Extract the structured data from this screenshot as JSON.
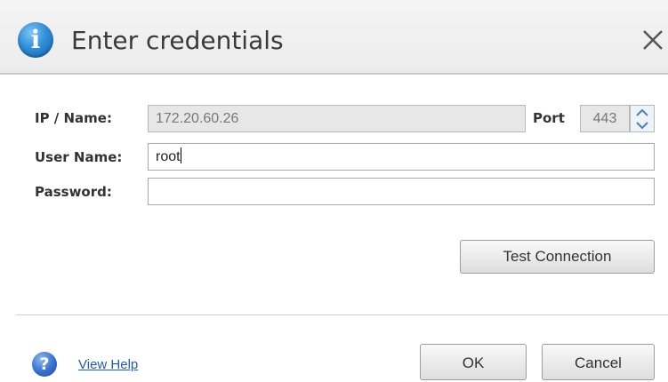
{
  "dialog": {
    "title": "Enter credentials",
    "icon": "info-icon",
    "close_icon": "close-icon"
  },
  "form": {
    "ip_label": "IP / Name:",
    "ip_value": "172.20.60.26",
    "port_label": "Port",
    "port_value": "443",
    "username_label": "User Name:",
    "username_value": "root",
    "password_label": "Password:",
    "password_value": ""
  },
  "buttons": {
    "test_connection": "Test Connection",
    "ok": "OK",
    "cancel": "Cancel"
  },
  "footer": {
    "help_icon": "help-icon",
    "help_link": "View Help"
  },
  "colors": {
    "accent": "#2f8fd8",
    "link": "#1f5bb5"
  }
}
